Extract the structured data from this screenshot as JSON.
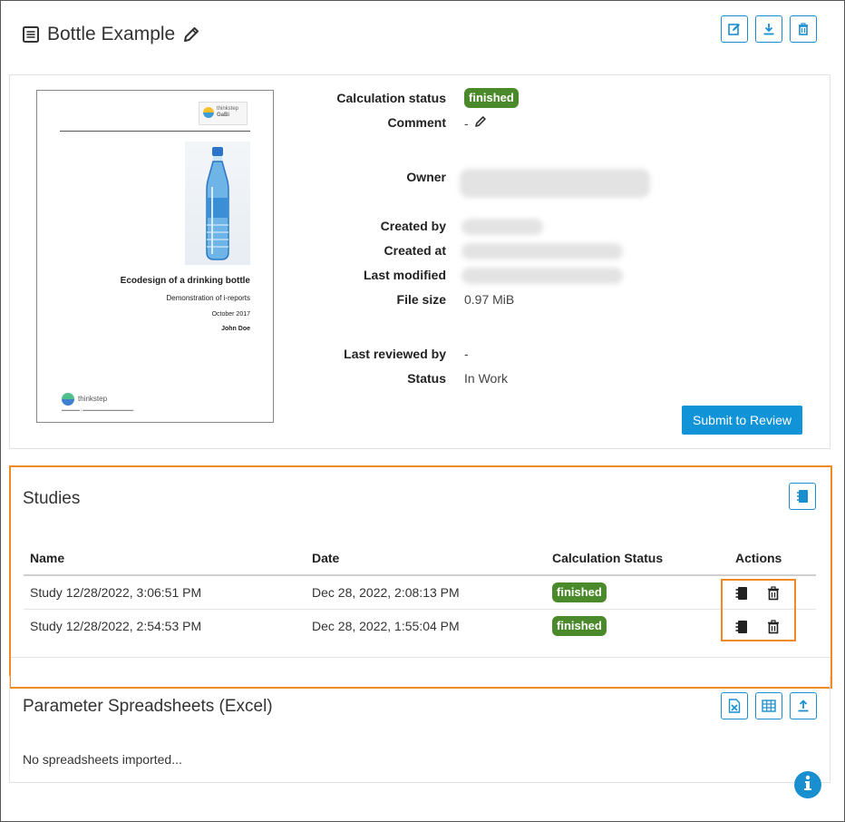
{
  "header": {
    "title": "Bottle Example",
    "icons": [
      "document-icon",
      "pencil-icon",
      "edit-icon",
      "download-icon",
      "trash-icon"
    ]
  },
  "cover": {
    "brand": "thinkstep",
    "product": "GaBi",
    "title": "Ecodesign of a drinking bottle",
    "subtitle": "Demonstration of i-reports",
    "date": "October 2017",
    "author": "John Doe",
    "footer_brand": "thinkstep"
  },
  "details": {
    "calc_status_label": "Calculation status",
    "calc_status_value": "finished",
    "comment_label": "Comment",
    "comment_value": "-",
    "owner_label": "Owner",
    "created_by_label": "Created by",
    "created_at_label": "Created at",
    "last_modified_label": "Last modified",
    "file_size_label": "File size",
    "file_size_value": "0.97 MiB",
    "last_reviewed_label": "Last reviewed by",
    "last_reviewed_value": "-",
    "status_label": "Status",
    "status_value": "In Work",
    "submit_label": "Submit to Review"
  },
  "studies": {
    "title": "Studies",
    "columns": [
      "Name",
      "Date",
      "Calculation Status",
      "Actions"
    ],
    "rows": [
      {
        "name": "Study 12/28/2022, 3:06:51 PM",
        "date": "Dec 28, 2022, 2:08:13 PM",
        "status": "finished"
      },
      {
        "name": "Study 12/28/2022, 2:54:53 PM",
        "date": "Dec 28, 2022, 1:55:04 PM",
        "status": "finished"
      }
    ]
  },
  "spreadsheets": {
    "title": "Parameter Spreadsheets (Excel)",
    "empty_text": "No spreadsheets imported..."
  },
  "colors": {
    "accent": "#1a8fd0",
    "badge_green": "#4a8a2a",
    "highlight": "#f08a24"
  }
}
